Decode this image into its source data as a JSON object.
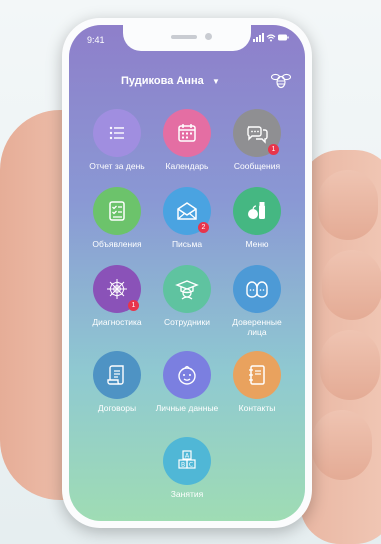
{
  "status": {
    "time": "9:41"
  },
  "header": {
    "user_name": "Пудикова Анна"
  },
  "tiles": [
    {
      "label": "Отчет за день",
      "color": "#a08ee0",
      "icon": "list-icon",
      "badge": ""
    },
    {
      "label": "Календарь",
      "color": "#e46ea3",
      "icon": "calendar-icon",
      "badge": ""
    },
    {
      "label": "Сообщения",
      "color": "#8f8f92",
      "icon": "chat-bubbles-icon",
      "badge": "1"
    },
    {
      "label": "Объявления",
      "color": "#6cc36b",
      "icon": "checklist-icon",
      "badge": ""
    },
    {
      "label": "Письма",
      "color": "#4aa3e1",
      "icon": "envelope-icon",
      "badge": "2"
    },
    {
      "label": "Меню",
      "color": "#45b782",
      "icon": "apple-jar-icon",
      "badge": ""
    },
    {
      "label": "Диагностика",
      "color": "#8a52b8",
      "icon": "cobweb-icon",
      "badge": "1"
    },
    {
      "label": "Сотрудники",
      "color": "#5fc3a0",
      "icon": "graduate-icon",
      "badge": ""
    },
    {
      "label": "Доверенные лица",
      "color": "#4d9ad6",
      "icon": "faces-icon",
      "badge": ""
    },
    {
      "label": "Договоры",
      "color": "#4e93c4",
      "icon": "scroll-icon",
      "badge": ""
    },
    {
      "label": "Личные данные",
      "color": "#7b7fe0",
      "icon": "baby-face-icon",
      "badge": ""
    },
    {
      "label": "Контакты",
      "color": "#e9a25e",
      "icon": "notebook-icon",
      "badge": ""
    },
    {
      "label": "Занятия",
      "color": "#50b7d6",
      "icon": "abc-blocks-icon",
      "badge": ""
    }
  ],
  "colors": {
    "screen_top": "#8e7fca",
    "screen_bottom": "#9fdcb4",
    "badge": "#e8354b"
  }
}
